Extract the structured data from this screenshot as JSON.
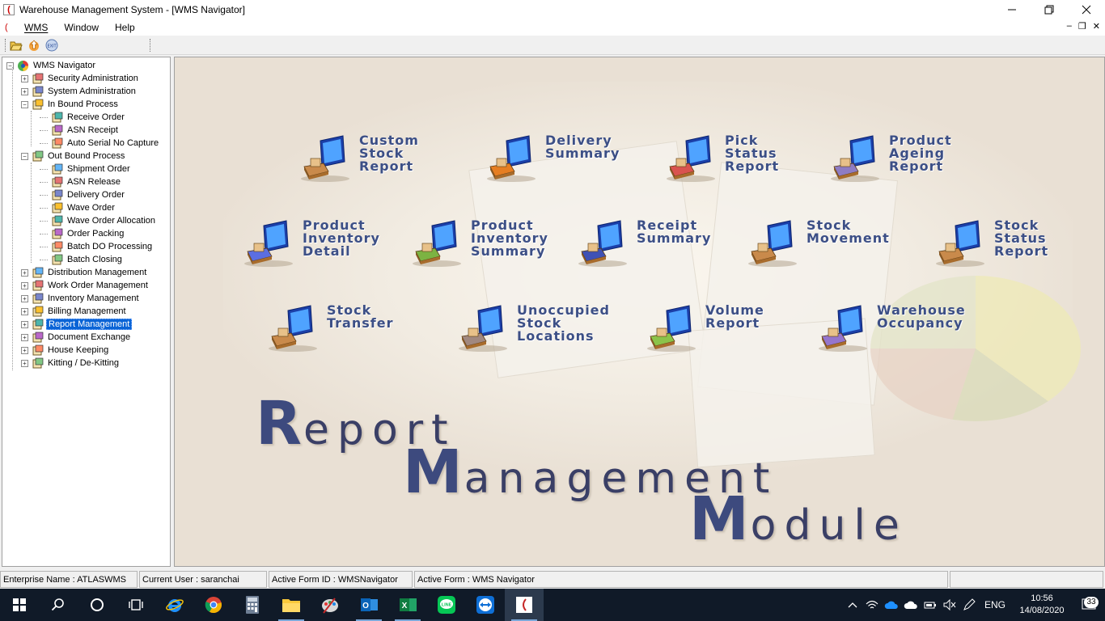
{
  "window": {
    "title": "Warehouse Management System - [WMS Navigator]",
    "app_icon": "ͨ",
    "minimize": "—",
    "maximize": "❐",
    "close": "✕"
  },
  "menu": {
    "items": [
      "WMS",
      "Window",
      "Help"
    ],
    "mdi_minimize": "–",
    "mdi_restore": "❐",
    "mdi_close": "✕"
  },
  "tree": {
    "root": "WMS Navigator",
    "items": [
      {
        "label": "Security Administration",
        "level": 1,
        "expander": "+"
      },
      {
        "label": "System Administration",
        "level": 1,
        "expander": "+"
      },
      {
        "label": "In Bound Process",
        "level": 1,
        "expander": "-"
      },
      {
        "label": "Receive Order",
        "level": 2
      },
      {
        "label": "ASN Receipt",
        "level": 2
      },
      {
        "label": "Auto Serial No Capture",
        "level": 2
      },
      {
        "label": "Out Bound Process",
        "level": 1,
        "expander": "-"
      },
      {
        "label": "Shipment Order",
        "level": 2
      },
      {
        "label": "ASN Release",
        "level": 2
      },
      {
        "label": "Delivery Order",
        "level": 2
      },
      {
        "label": "Wave Order",
        "level": 2
      },
      {
        "label": "Wave Order Allocation",
        "level": 2
      },
      {
        "label": "Order Packing",
        "level": 2
      },
      {
        "label": "Batch DO Processing",
        "level": 2
      },
      {
        "label": "Batch Closing",
        "level": 2
      },
      {
        "label": "Distribution Management",
        "level": 1,
        "expander": "+"
      },
      {
        "label": "Work Order Management",
        "level": 1,
        "expander": "+"
      },
      {
        "label": "Inventory Management",
        "level": 1,
        "expander": "+"
      },
      {
        "label": "Billing Management",
        "level": 1,
        "expander": "+"
      },
      {
        "label": "Report Management",
        "level": 1,
        "expander": "+",
        "selected": true
      },
      {
        "label": "Document Exchange",
        "level": 1,
        "expander": "+"
      },
      {
        "label": "House Keeping",
        "level": 1,
        "expander": "+"
      },
      {
        "label": "Kitting / De-Kitting",
        "level": 1,
        "expander": "+"
      }
    ]
  },
  "reports": [
    {
      "id": "custom-stock-report",
      "label": "Custom\nStock\nReport",
      "icon": "boxes-icon"
    },
    {
      "id": "delivery-summary",
      "label": "Delivery\nSummary",
      "icon": "delivery-person-icon"
    },
    {
      "id": "pick-status-report",
      "label": "Pick\nStatus\nReport",
      "icon": "picker-icon"
    },
    {
      "id": "product-ageing-report",
      "label": "Product\nAgeing\nReport",
      "icon": "clock-icon"
    },
    {
      "id": "product-inventory-detail",
      "label": "Product\nInventory\nDetail",
      "icon": "inventory-detail-icon"
    },
    {
      "id": "product-inventory-summary",
      "label": "Product\nInventory\nSummary",
      "icon": "inventory-summary-icon"
    },
    {
      "id": "receipt-summary",
      "label": "Receipt\nSummary",
      "icon": "receipt-icon"
    },
    {
      "id": "stock-movement",
      "label": "Stock\nMovement",
      "icon": "stock-movement-icon"
    },
    {
      "id": "stock-status-report",
      "label": "Stock\nStatus\nReport",
      "icon": "stock-status-icon"
    },
    {
      "id": "stock-transfer",
      "label": "Stock\nTransfer",
      "icon": "stock-transfer-icon"
    },
    {
      "id": "unoccupied-stock-locations",
      "label": "Unoccupied\nStock\nLocations",
      "icon": "unoccupied-icon"
    },
    {
      "id": "volume-report",
      "label": "Volume\nReport",
      "icon": "volume-icon"
    },
    {
      "id": "warehouse-occupancy",
      "label": "Warehouse\nOccupancy",
      "icon": "warehouse-icon"
    }
  ],
  "banner": {
    "line1_cap": "R",
    "line1_rest": "eport",
    "line2_cap": "M",
    "line2_rest": "anagement",
    "line3_cap": "M",
    "line3_rest": "odule"
  },
  "status": {
    "enterprise": "Enterprise Name :  ATLASWMS",
    "user": "Current User :  saranchai",
    "form_id": "Active Form ID :  WMSNavigator",
    "form": "Active Form :  WMS Navigator",
    "extra": ""
  },
  "taskbar": {
    "apps": [
      "windows-start",
      "search",
      "cortana",
      "task-view",
      "internet-explorer",
      "chrome",
      "calculator",
      "file-explorer",
      "paint-app",
      "outlook",
      "excel",
      "line",
      "teamviewer",
      "wms-app"
    ],
    "language": "ENG",
    "time": "10:56",
    "date": "14/08/2020",
    "notifications": "33"
  },
  "colors": {
    "accent": "#0a64d6",
    "report_text": "#3c4f86",
    "taskbar": "#101a28"
  }
}
